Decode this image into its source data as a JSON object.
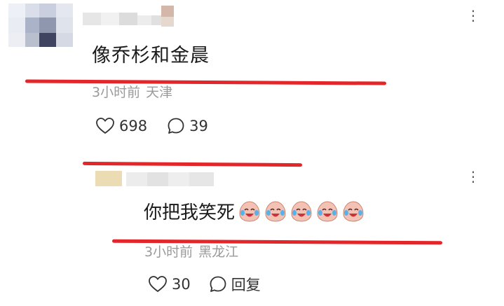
{
  "comments": [
    {
      "text": "像乔杉和金晨",
      "time": "3小时前",
      "location": "天津",
      "likes": "698",
      "replies": "39",
      "more_glyph": "⋮"
    },
    {
      "text": "你把我笑死",
      "emojis": [
        "crying-laughing-emoji",
        "crying-laughing-emoji",
        "crying-laughing-emoji",
        "crying-laughing-emoji",
        "crying-laughing-emoji"
      ],
      "time": "3小时前",
      "location": "黑龙江",
      "likes": "30",
      "reply_label": "回复",
      "more_glyph": "⋮"
    }
  ],
  "colors": {
    "annotation_red": "#e3262a",
    "meta_gray": "#9a9a9a",
    "text": "#1a1a1a"
  },
  "icons": [
    "heart-icon",
    "comment-bubble-icon",
    "more-icon"
  ]
}
